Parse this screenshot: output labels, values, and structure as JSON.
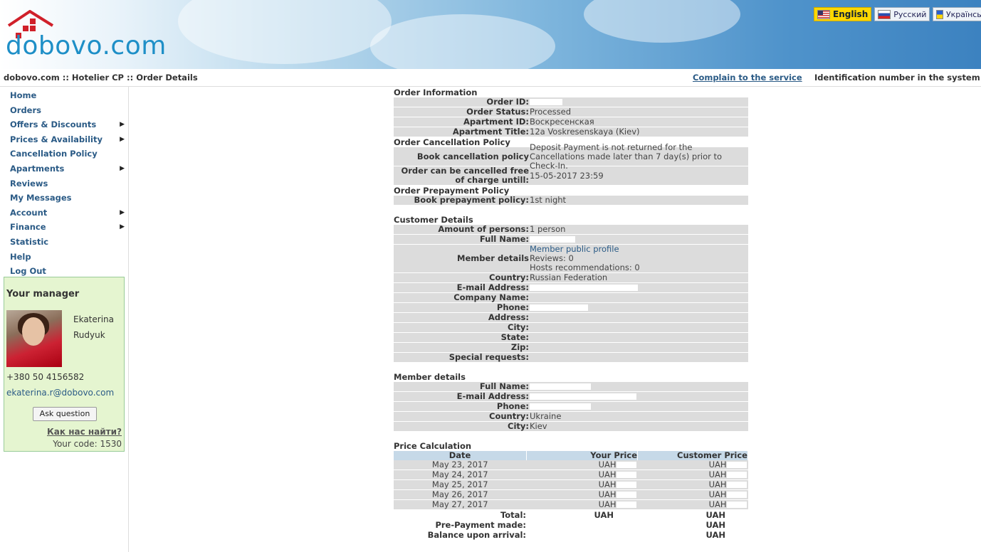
{
  "brand": {
    "logo_text": "dobovo.com"
  },
  "languages": [
    {
      "label": "English",
      "active": true
    },
    {
      "label": "Русский",
      "active": false
    },
    {
      "label": "Українськ",
      "active": false
    }
  ],
  "topbar": {
    "breadcrumb": "dobovo.com :: Hotelier CP :: Order Details",
    "complain": "Complain to the service",
    "id_label": "Identification number in the system :"
  },
  "menu": [
    {
      "label": "Home",
      "submenu": false
    },
    {
      "label": "Orders",
      "submenu": false
    },
    {
      "label": "Offers & Discounts",
      "submenu": true
    },
    {
      "label": "Prices & Availability",
      "submenu": true
    },
    {
      "label": "Cancellation Policy",
      "submenu": false
    },
    {
      "label": "Apartments",
      "submenu": true
    },
    {
      "label": "Reviews",
      "submenu": false
    },
    {
      "label": "My Messages",
      "submenu": false
    },
    {
      "label": "Account",
      "submenu": true
    },
    {
      "label": "Finance",
      "submenu": true
    },
    {
      "label": "Statistic",
      "submenu": false
    },
    {
      "label": "Help",
      "submenu": false
    },
    {
      "label": "Log Out",
      "submenu": false
    }
  ],
  "manager": {
    "title": "Your manager",
    "first_name": "Ekaterina",
    "last_name": "Rudyuk",
    "phone": "+380 50 4156582",
    "email": "ekaterina.r@dobovo.com",
    "ask_button": "Ask question",
    "find_us": "Как нас найти?",
    "code": "Your code: 1530"
  },
  "order_info": {
    "title": "Order Information",
    "rows": [
      {
        "label": "Order ID:",
        "value": ""
      },
      {
        "label": "Order Status:",
        "value": "Processed"
      },
      {
        "label": "Apartment ID:",
        "value": "Воскресенская"
      },
      {
        "label": "Apartment Title:",
        "value": "12a Voskresenskaya (Kiev)"
      }
    ]
  },
  "cancellation": {
    "title": "Order Cancellation Policy",
    "policy_label": "Book cancellation policy",
    "policy_value": "Deposit Payment is not returned for the Cancellations made later than 7 day(s) prior to Check-In.",
    "free_label": "Order can be cancelled free of charge untill:",
    "free_value": "15-05-2017 23:59"
  },
  "prepayment": {
    "title": "Order Prepayment Policy",
    "label": "Book prepayment policy:",
    "value": "1st night"
  },
  "customer": {
    "title": "Customer Details",
    "persons_label": "Amount of persons:",
    "persons_value": "1 person",
    "fullname_label": "Full Name:",
    "member_label": "Member details",
    "member_profile": "Member public profile",
    "member_reviews": "Reviews: 0",
    "member_recs": "Hosts recommendations: 0",
    "country_label": "Country:",
    "country_value": "Russian Federation",
    "email_label": "E-mail Address:",
    "company_label": "Company Name:",
    "phone_label": "Phone:",
    "address_label": "Address:",
    "city_label": "City:",
    "state_label": "State:",
    "zip_label": "Zip:",
    "special_label": "Special requests:"
  },
  "member": {
    "title": "Member details",
    "fullname_label": "Full Name:",
    "email_label": "E-mail Address:",
    "phone_label": "Phone:",
    "country_label": "Country:",
    "country_value": "Ukraine",
    "city_label": "City:",
    "city_value": "Kiev"
  },
  "price": {
    "title": "Price Calculation",
    "col_date": "Date",
    "col_your": "Your Price",
    "col_customer": "Customer Price",
    "currency": "UAH",
    "dates": [
      "May 23, 2017",
      "May 24, 2017",
      "May 25, 2017",
      "May 26, 2017",
      "May 27, 2017"
    ],
    "total_label": "Total:",
    "prepay_label": "Pre-Payment made:",
    "balance_label": "Balance upon arrival:"
  },
  "colors": {
    "link": "#2b5b86",
    "accent": "#ffd800",
    "row_bg": "#dcdcdc",
    "header_bg": "#c6d9e8",
    "manager_bg": "#e5f5d0"
  }
}
